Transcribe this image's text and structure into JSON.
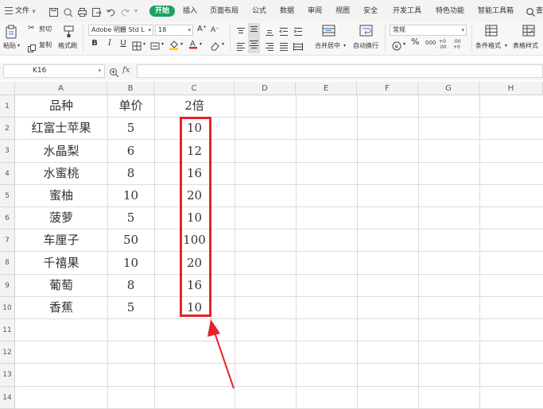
{
  "menubar": {
    "file": "文件",
    "tabs": [
      "开始",
      "插入",
      "页面布局",
      "公式",
      "数据",
      "审阅",
      "视图",
      "安全",
      "开发工具",
      "特色功能",
      "智能工具箱"
    ],
    "search": "查"
  },
  "ribbon": {
    "paste": "粘贴",
    "cut": "剪切",
    "copy": "复制",
    "format_painter": "格式刷",
    "font_name": "Adobe 明體 Std L",
    "font_size": "18",
    "grow_font": "A⁺",
    "shrink_font": "A⁻",
    "bold": "B",
    "italic": "I",
    "underline": "U",
    "merge_center": "合并居中",
    "wrap_text": "自动换行",
    "number_format": "常规",
    "percent": "%",
    "thousands": "000",
    "inc_decimal": "+0 .00",
    "dec_decimal": ".00 +0",
    "conditional_format": "条件格式",
    "table_style": "表格样式"
  },
  "formula_bar": {
    "cell_ref": "K16",
    "fx": "fx",
    "content": ""
  },
  "sheet": {
    "columns": [
      "A",
      "B",
      "C",
      "D",
      "E",
      "F",
      "G",
      "H"
    ],
    "rows": [
      "1",
      "2",
      "3",
      "4",
      "5",
      "6",
      "7",
      "8",
      "9",
      "10",
      "11",
      "12",
      "13",
      "14"
    ],
    "headers": [
      "品种",
      "单价",
      "2倍"
    ],
    "data": [
      [
        "红富士苹果",
        "5",
        "10"
      ],
      [
        "水晶梨",
        "6",
        "12"
      ],
      [
        "水蜜桃",
        "8",
        "16"
      ],
      [
        "蜜柚",
        "10",
        "20"
      ],
      [
        "菠萝",
        "5",
        "10"
      ],
      [
        "车厘子",
        "50",
        "100"
      ],
      [
        "千禧果",
        "10",
        "20"
      ],
      [
        "葡萄",
        "8",
        "16"
      ],
      [
        "香蕉",
        "5",
        "10"
      ]
    ]
  },
  "colors": {
    "accent_green": "#1aa260",
    "highlight_red": "#e8222a"
  }
}
